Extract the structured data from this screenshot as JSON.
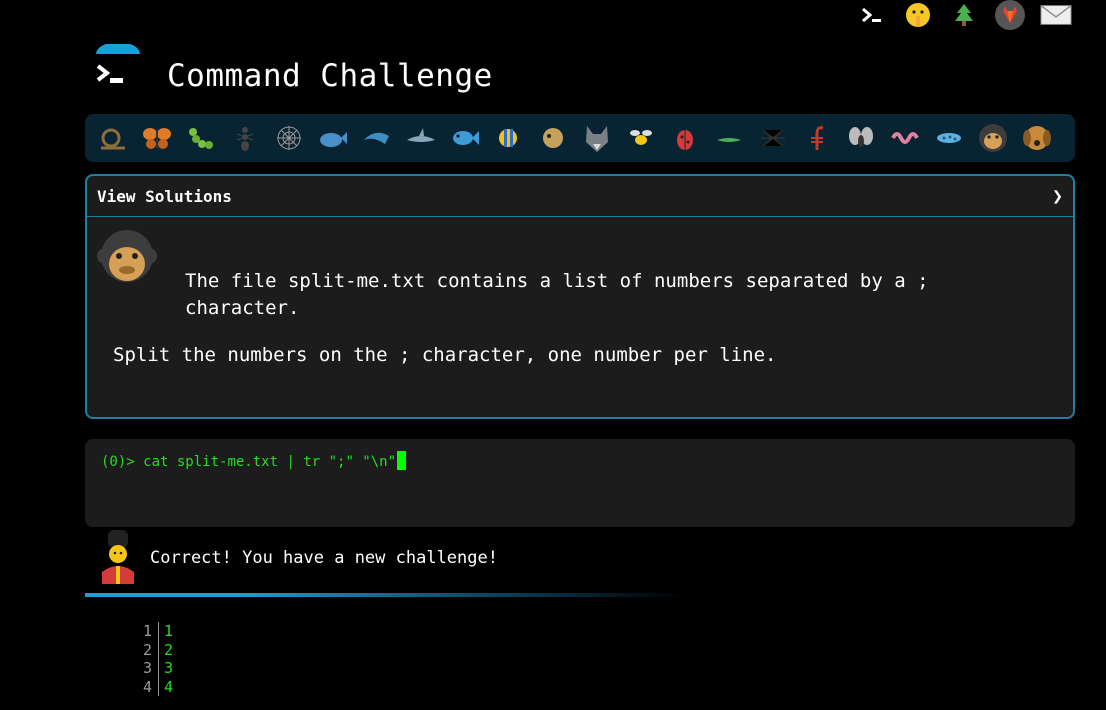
{
  "header": {
    "title": "Command Challenge",
    "icons": [
      "terminal-icon",
      "shushing-face-icon",
      "tree-icon",
      "gitlab-icon",
      "envelope-icon"
    ]
  },
  "animals": [
    "snail-icon",
    "butterfly-icon",
    "caterpillar-icon",
    "ant-icon",
    "spider-web-icon",
    "whale-icon",
    "dolphin-icon",
    "shark-icon",
    "fish-icon",
    "tropical-fish-icon",
    "blowfish-icon",
    "wolf-icon",
    "bee-icon",
    "ladybug-icon",
    "lizard-icon",
    "spider-icon",
    "scorpion-icon",
    "fly-icon",
    "worm-icon",
    "microbe-icon",
    "chimpanzee-icon",
    "dog-icon"
  ],
  "panel": {
    "toggle_label": "View Solutions",
    "chevron": "❯",
    "description": "The file split-me.txt contains a list of numbers separated by a ; character.",
    "instruction": "Split the numbers on the ; character, one number per line."
  },
  "terminal": {
    "prompt": "(0)> ",
    "command": "cat split-me.txt | tr \";\" \"\\n\""
  },
  "feedback": {
    "message": "Correct! You have a new challenge!"
  },
  "output": {
    "rows": [
      {
        "line": "1",
        "value": "1"
      },
      {
        "line": "2",
        "value": "2"
      },
      {
        "line": "3",
        "value": "3"
      },
      {
        "line": "4",
        "value": "4"
      }
    ]
  },
  "colors": {
    "accent": "#1aa0d8",
    "terminal_green": "#22dd22",
    "panel_bg": "#1c1c1c",
    "animal_bar_bg": "#082331"
  }
}
